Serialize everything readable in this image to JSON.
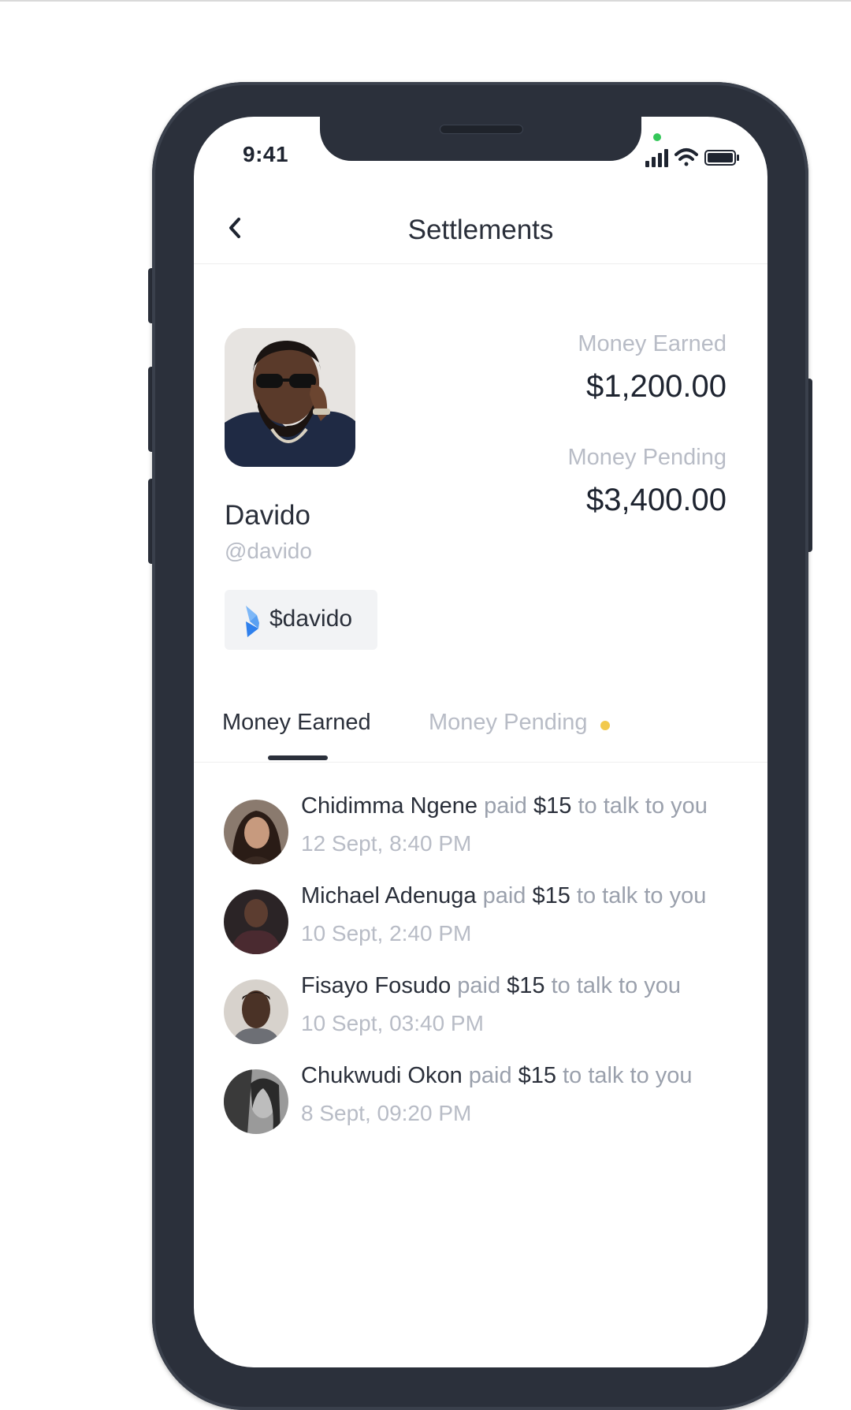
{
  "status_bar": {
    "time": "9:41"
  },
  "header": {
    "title": "Settlements"
  },
  "profile": {
    "name": "Davido",
    "handle": "@davido",
    "cashtag": "$davido"
  },
  "stats": {
    "earned_label": "Money Earned",
    "earned_value": "$1,200.00",
    "pending_label": "Money Pending",
    "pending_value": "$3,400.00"
  },
  "tabs": [
    {
      "label": "Money Earned",
      "active": true
    },
    {
      "label": "Money Pending",
      "active": false
    }
  ],
  "transactions": [
    {
      "name": "Chidimma Ngene",
      "paid": "paid",
      "amount": "$15",
      "suffix": "to talk to you",
      "date": "12 Sept, 8:40 PM"
    },
    {
      "name": "Michael Adenuga",
      "paid": "paid",
      "amount": "$15",
      "suffix": "to talk to you",
      "date": "10 Sept, 2:40 PM"
    },
    {
      "name": "Fisayo Fosudo",
      "paid": "paid",
      "amount": "$15",
      "suffix": "to talk to you",
      "date": "10 Sept, 03:40 PM"
    },
    {
      "name": "Chukwudi Okon",
      "paid": "paid",
      "amount": "$15",
      "suffix": "to talk to you",
      "date": "8 Sept, 09:20 PM"
    }
  ],
  "colors": {
    "frame": "#2b303b",
    "text_primary": "#2a2f3a",
    "text_muted": "#b8bcc6",
    "pending_dot": "#f2c94c",
    "camera_dot": "#34c759",
    "cashtag_bg": "#f2f3f5",
    "brand_blue": "#2f80ed"
  },
  "icons": {
    "back": "chevron-left-icon",
    "signal": "signal-icon",
    "wifi": "wifi-icon",
    "battery": "battery-icon",
    "cashtag_logo": "brand-logo-icon"
  }
}
